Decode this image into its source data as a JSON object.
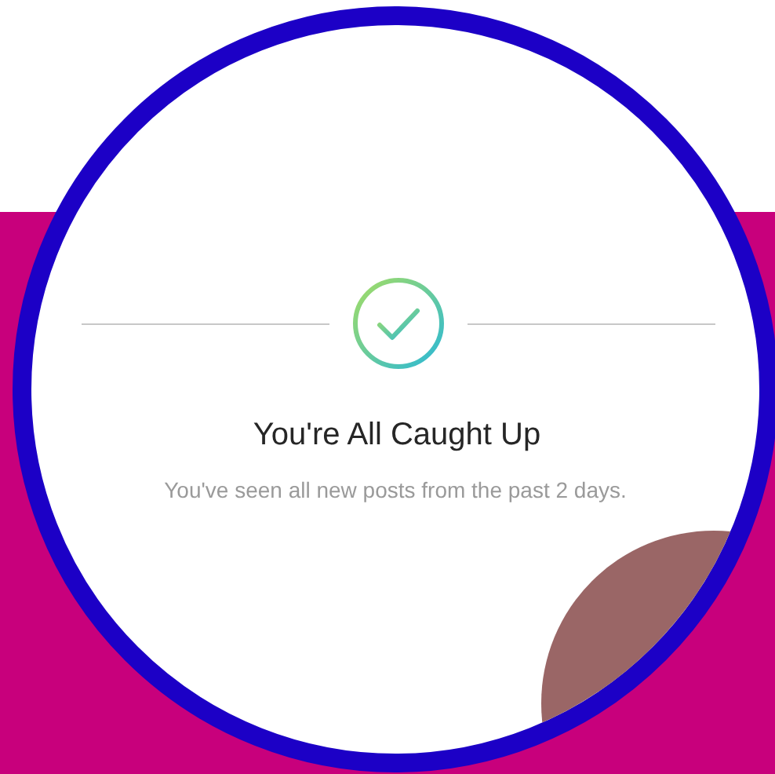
{
  "title": "You're All Caught Up",
  "subtitle": "You've seen all new posts from the past 2 days."
}
